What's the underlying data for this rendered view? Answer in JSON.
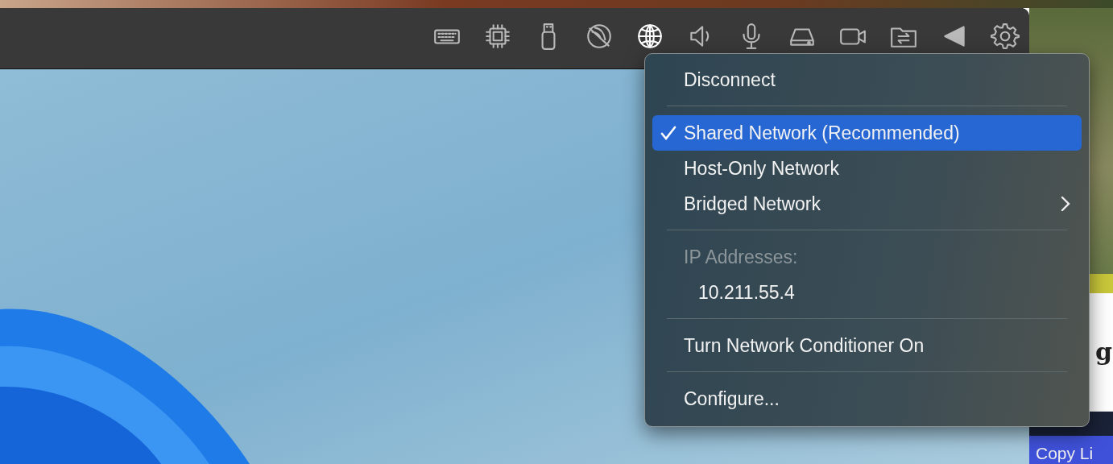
{
  "toolbar": {
    "buttons": [
      {
        "kind": "keyboard",
        "selected": false
      },
      {
        "kind": "cpu",
        "selected": false
      },
      {
        "kind": "usb",
        "selected": false
      },
      {
        "kind": "no-network",
        "selected": false
      },
      {
        "kind": "globe",
        "selected": true
      },
      {
        "kind": "speaker",
        "selected": false
      },
      {
        "kind": "microphone",
        "selected": false
      },
      {
        "kind": "drive",
        "selected": false
      },
      {
        "kind": "camera",
        "selected": false
      },
      {
        "kind": "shared-folder",
        "selected": false
      },
      {
        "kind": "triangle",
        "selected": false
      },
      {
        "kind": "gear",
        "selected": false
      }
    ]
  },
  "network_menu": {
    "items": [
      {
        "kind": "item",
        "label": "Disconnect",
        "checked": false,
        "selected": false
      },
      {
        "kind": "separator"
      },
      {
        "kind": "item",
        "label": "Shared Network (Recommended)",
        "checked": true,
        "selected": true
      },
      {
        "kind": "item",
        "label": "Host-Only Network",
        "checked": false,
        "selected": false
      },
      {
        "kind": "submenu",
        "label": "Bridged Network",
        "checked": false,
        "selected": false
      },
      {
        "kind": "separator"
      },
      {
        "kind": "header",
        "label": "IP Addresses:"
      },
      {
        "kind": "value",
        "label": "10.211.55.4"
      },
      {
        "kind": "separator"
      },
      {
        "kind": "item",
        "label": "Turn Network Conditioner On",
        "checked": false,
        "selected": false
      },
      {
        "kind": "separator"
      },
      {
        "kind": "item",
        "label": "Configure...",
        "checked": false,
        "selected": false
      }
    ]
  },
  "background_window": {
    "text_fragment": "g",
    "button_label": "Copy Li"
  }
}
